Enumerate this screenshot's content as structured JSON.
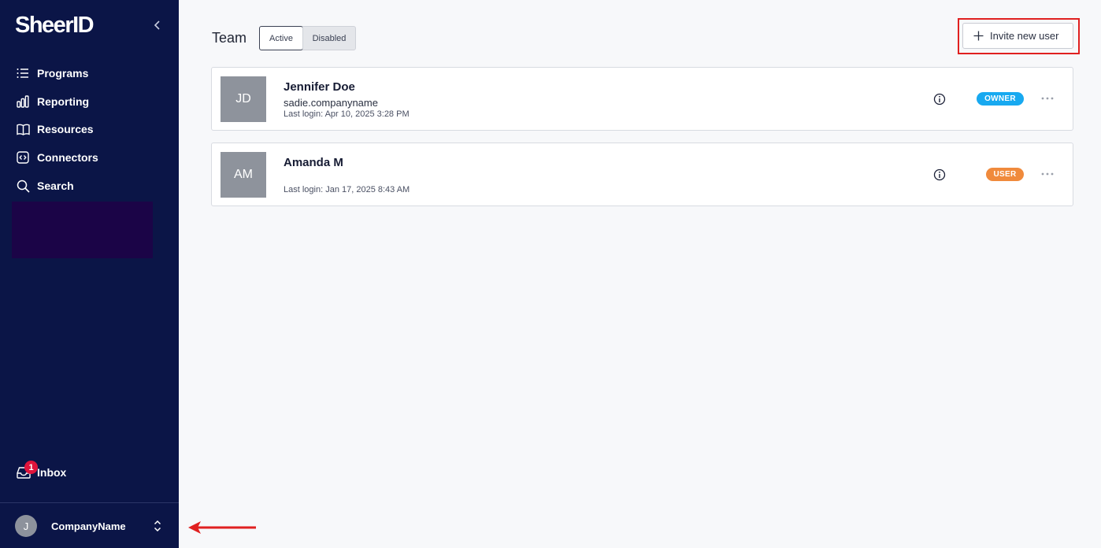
{
  "brand": {
    "name": "SheerID"
  },
  "sidebar": {
    "items": [
      {
        "label": "Programs",
        "icon": "list-icon"
      },
      {
        "label": "Reporting",
        "icon": "bar-chart-icon"
      },
      {
        "label": "Resources",
        "icon": "book-icon"
      },
      {
        "label": "Connectors",
        "icon": "code-icon"
      },
      {
        "label": "Search",
        "icon": "search-icon"
      }
    ],
    "inbox": {
      "label": "Inbox",
      "badge": "1"
    },
    "account": {
      "initial": "J",
      "name": "CompanyName"
    }
  },
  "main": {
    "title": "Team",
    "filters": {
      "active": "Active",
      "disabled": "Disabled"
    },
    "invite_label": "Invite new user",
    "users": [
      {
        "initials": "JD",
        "name": "Jennifer Doe",
        "email": "sadie.companyname",
        "last_login": "Last login: Apr 10, 2025 3:28 PM",
        "role": "OWNER",
        "role_color": "#18a9f0"
      },
      {
        "initials": "AM",
        "name": "Amanda M",
        "email": "",
        "last_login": "Last login: Jan 17, 2025 8:43 AM",
        "role": "USER",
        "role_color": "#f08a3c"
      }
    ]
  },
  "colors": {
    "sidebar_bg": "#0b1547",
    "annotation_red": "#e02020"
  }
}
